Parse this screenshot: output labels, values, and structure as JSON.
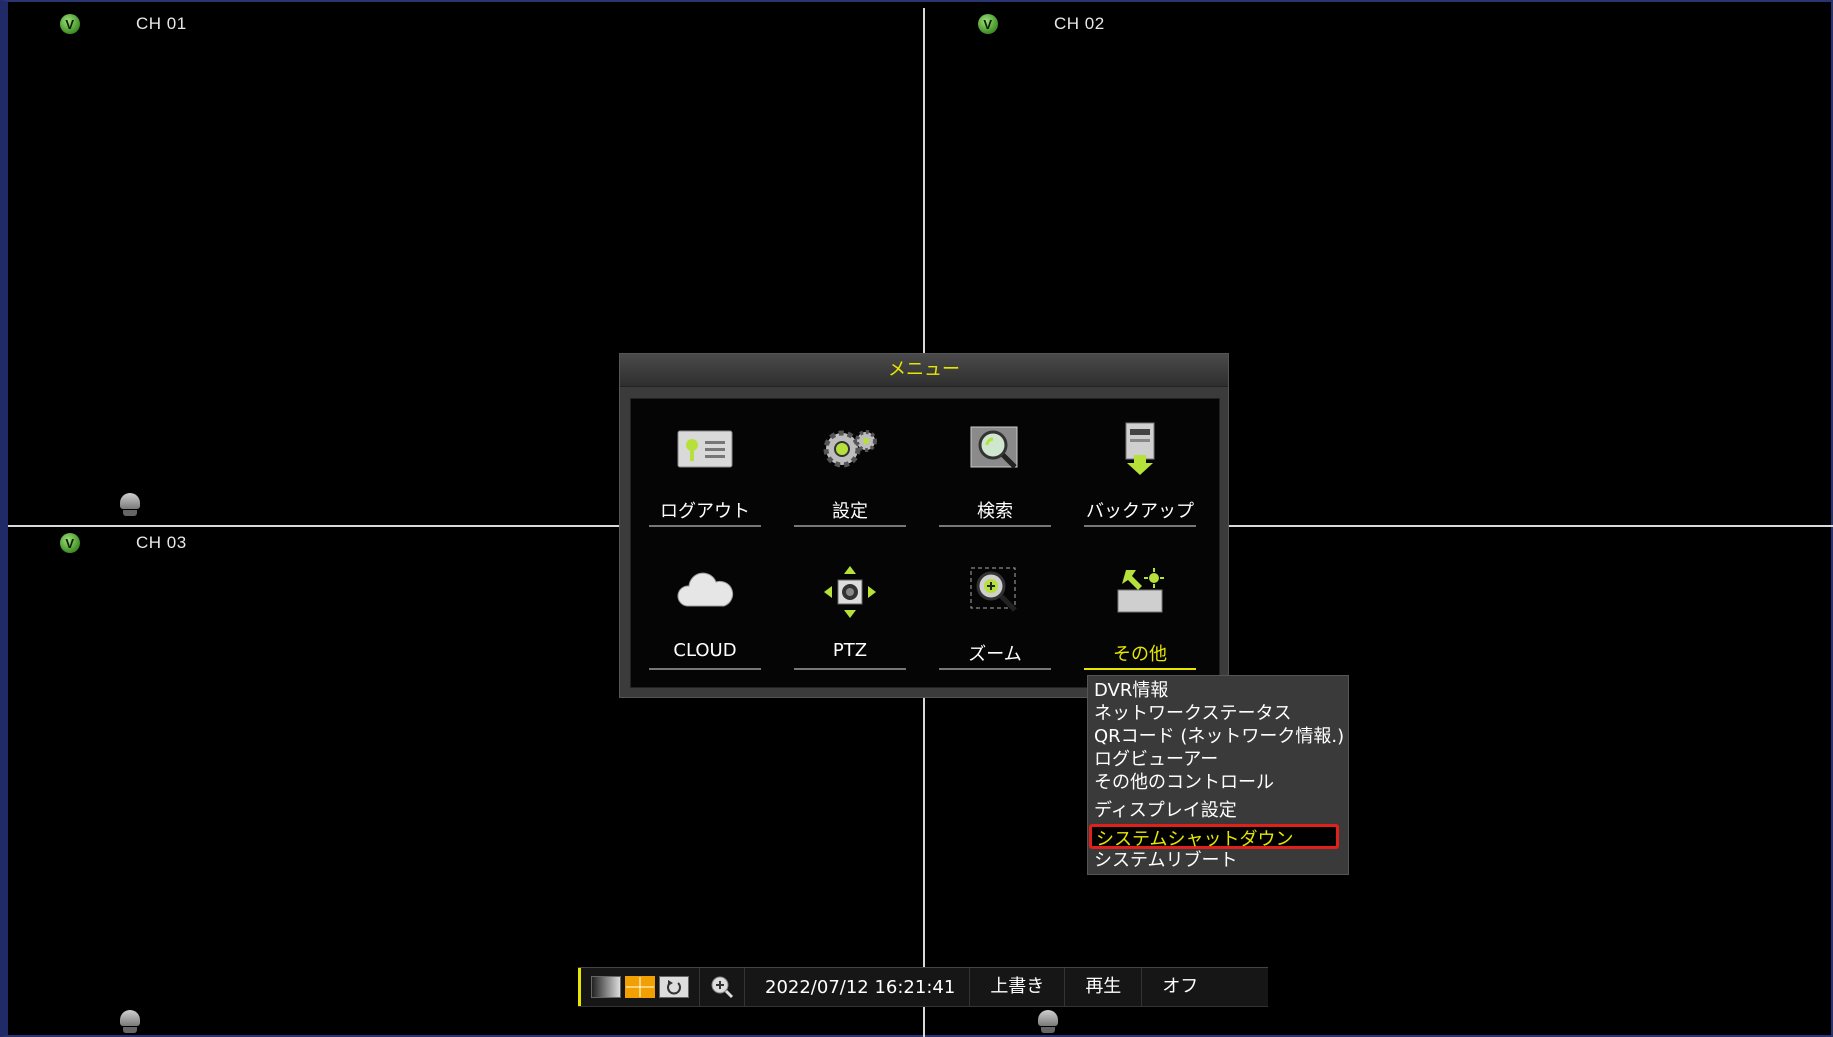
{
  "channels": [
    {
      "label": "CH 01",
      "badge": "V"
    },
    {
      "label": "CH 02",
      "badge": "V"
    },
    {
      "label": "CH 03",
      "badge": "V"
    }
  ],
  "menu": {
    "title": "メニュー",
    "items": [
      {
        "label": "ログアウト",
        "icon": "logout-icon"
      },
      {
        "label": "設定",
        "icon": "gear-icon"
      },
      {
        "label": "検索",
        "icon": "search-icon"
      },
      {
        "label": "バックアップ",
        "icon": "backup-icon"
      },
      {
        "label": "CLOUD",
        "icon": "cloud-icon"
      },
      {
        "label": "PTZ",
        "icon": "ptz-icon"
      },
      {
        "label": "ズーム",
        "icon": "zoom-icon"
      },
      {
        "label": "その他",
        "icon": "tools-icon",
        "selected": true
      }
    ]
  },
  "submenu": {
    "items": [
      {
        "label": "DVR情報"
      },
      {
        "label": "ネットワークステータス"
      },
      {
        "label": "QRコード (ネットワーク情報.)"
      },
      {
        "label": "ログビューアー"
      },
      {
        "label": "その他のコントロール"
      },
      {
        "label": "ディスプレイ設定"
      },
      {
        "label": "システムシャットダウン",
        "highlighted": true
      },
      {
        "label": "システムリブート"
      }
    ]
  },
  "toolbar": {
    "datetime": "2022/07/12 16:21:41",
    "overwrite": "上書き",
    "playback": "再生",
    "off": "オフ"
  },
  "colors": {
    "accent": "#e6e600",
    "highlight_border": "#e0201a",
    "badge": "#3f8f24"
  }
}
